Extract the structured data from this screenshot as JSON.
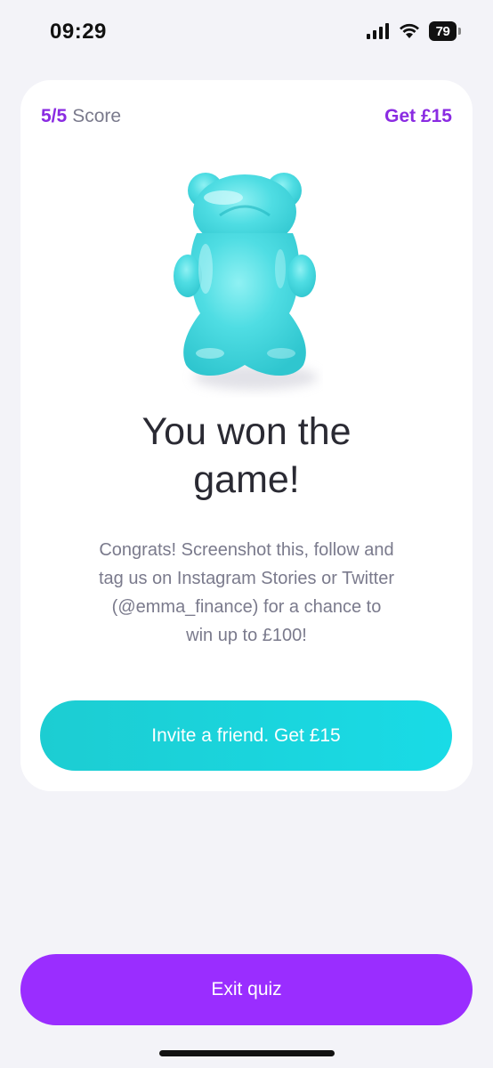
{
  "status_bar": {
    "time": "09:29",
    "battery_level": "79",
    "icons": [
      "signal-icon",
      "wifi-icon",
      "battery-icon"
    ]
  },
  "card": {
    "score_value": "5/5",
    "score_label": "Score",
    "reward_link": "Get £15",
    "image": "gummy-bear-icon",
    "title_lines": [
      "You won the",
      "game!"
    ],
    "message_lines": [
      "Congrats! Screenshot this, follow and",
      "tag us on Instagram Stories or Twitter",
      "(@emma_finance) for a chance to",
      "win up to £100!"
    ],
    "invite_button_label": "Invite a friend. Get £15"
  },
  "exit_button_label": "Exit quiz",
  "colors": {
    "accent_purple": "#9a2dff",
    "accent_teal": "#1ccdd2",
    "bear": "#3fd8df",
    "background": "#f3f3f8"
  }
}
